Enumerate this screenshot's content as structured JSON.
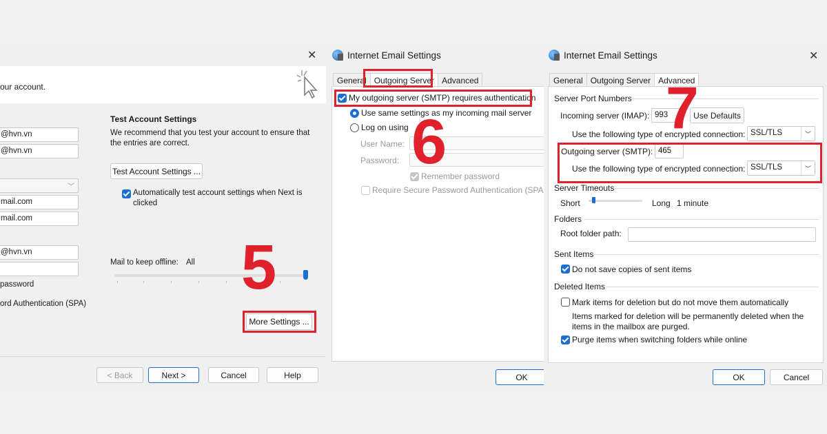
{
  "panel1": {
    "close_glyph": "✕",
    "header_text": "our account.",
    "fields": [
      "@hvn.vn",
      "@hvn.vn",
      "",
      "mail.com",
      "mail.com",
      "@hvn.vn",
      ""
    ],
    "remember_password_text": "password",
    "spa_text": "ord Authentication (SPA)",
    "test_heading": "Test Account Settings",
    "test_desc_1": "We recommend that you test your account to ensure that",
    "test_desc_2": "the entries are correct.",
    "test_button": "Test Account Settings ...",
    "auto_test_1": "Automatically test account settings when Next is",
    "auto_test_2": "clicked",
    "offline_label": "Mail to keep offline:",
    "offline_value": "All",
    "offline_level_fraction": 1.0,
    "more_settings": "More Settings ...",
    "back": "< Back",
    "next": "Next >",
    "cancel": "Cancel",
    "help": "Help",
    "step_number": "5"
  },
  "panel2": {
    "title": "Internet Email Settings",
    "tabs": [
      "General",
      "Outgoing Server",
      "Advanced"
    ],
    "smtp_auth": "My outgoing server (SMTP) requires authentication",
    "use_same": "Use same settings as my incoming mail server",
    "log_on_using": "Log on using",
    "user_name_label": "User Name:",
    "password_label": "Password:",
    "remember_password": "Remember password",
    "require_spa": "Require Secure Password Authentication (SPA)",
    "ok": "OK",
    "step_number": "6"
  },
  "panel3": {
    "title": "Internet Email Settings",
    "close_glyph": "✕",
    "tabs": [
      "General",
      "Outgoing Server",
      "Advanced"
    ],
    "server_port_numbers": "Server Port Numbers",
    "incoming_label": "Incoming server (IMAP):",
    "incoming_value": "993",
    "use_defaults": "Use Defaults",
    "encrypted_label": "Use the following type of encrypted connection:",
    "incoming_encryption": "SSL/TLS",
    "outgoing_label": "Outgoing server (SMTP):",
    "outgoing_value": "465",
    "outgoing_encryption": "SSL/TLS",
    "server_timeouts": "Server Timeouts",
    "short": "Short",
    "long": "Long",
    "timeout_value": "1 minute",
    "timeout_level_fraction": 0.0,
    "folders": "Folders",
    "root_folder_label": "Root folder path:",
    "root_folder_value": "",
    "sent_items": "Sent Items",
    "no_copies": "Do not save copies of sent items",
    "deleted_items": "Deleted Items",
    "mark_items": "Mark items for deletion but do not move them automatically",
    "marked_note_1": "Items marked for deletion will be permanently deleted when the",
    "marked_note_2": "items in the mailbox are purged.",
    "purge_items": "Purge items when switching folders while online",
    "ok": "OK",
    "cancel": "Cancel",
    "step_number": "7"
  },
  "colors": {
    "accent": "#1a6fd0",
    "highlight_red": "#e0202a"
  },
  "icons": [
    "close-icon",
    "cursor-sparkle-icon",
    "email-settings-icon",
    "chevron-down-icon"
  ]
}
